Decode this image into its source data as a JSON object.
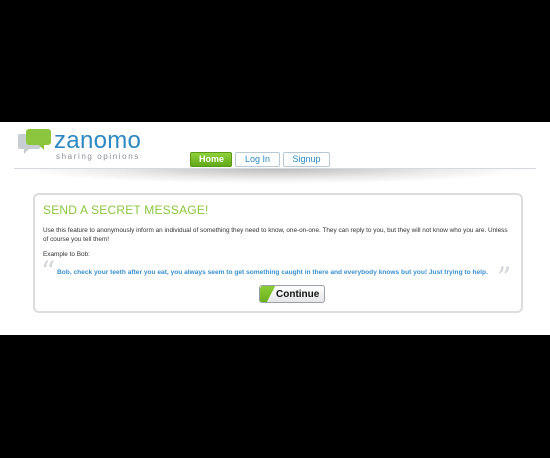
{
  "brand": {
    "name": "zanomo",
    "tagline": "sharing opinions",
    "primary_color": "#2d88c4",
    "accent_color": "#8cc63e"
  },
  "nav": {
    "home": "Home",
    "login": "Log In",
    "signup": "Signup",
    "active": "home"
  },
  "message": {
    "title": "SEND A SECRET MESSAGE!",
    "description": "Use this feature to anonymously inform an individual of something they need to know, one-on-one. They can reply to you, but they will not know who you are. Unless of course you tell them!",
    "example_label": "Example to Bob:",
    "example_quote": "Bob, check your teeth after you eat, you always seem to get something caught in there and everybody knows but you! Just trying to help.",
    "continue_label": "Continue"
  },
  "icons": [
    "speech-bubbles-logo-icon",
    "open-quote-icon",
    "close-quote-icon"
  ]
}
